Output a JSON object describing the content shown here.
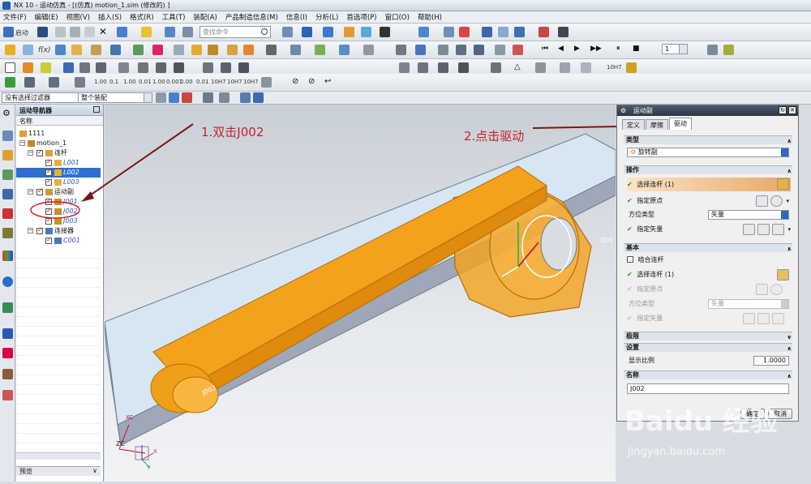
{
  "window": {
    "title": "NX 10 - 运动仿真 - [(仿真) motion_1.sim (修改的) ]"
  },
  "menu": [
    "文件(F)",
    "编辑(E)",
    "视图(V)",
    "插入(S)",
    "格式(R)",
    "工具(T)",
    "装配(A)",
    "产品制造信息(M)",
    "信息(I)",
    "分析(L)",
    "首选项(P)",
    "窗口(O)",
    "帮助(H)"
  ],
  "toolbar": {
    "start_label": "启动",
    "search_placeholder": "查找命令",
    "frame_value": "1",
    "tol_values": [
      "1.00",
      "0.1",
      "1.00",
      "0.01",
      "1.00",
      "0.001",
      "0.00",
      "0.01",
      "0.001",
      "0.0001",
      "10H7",
      "10H7",
      "10H7"
    ]
  },
  "filter": {
    "selection_filter": "没有选择过滤器",
    "assembly_scope": "整个装配"
  },
  "navigator": {
    "title": "运动导航器",
    "column_name": "名称",
    "items": [
      {
        "label": "1111",
        "indent": 0
      },
      {
        "label": "motion_1",
        "indent": 1
      },
      {
        "label": "连杆",
        "indent": 2
      },
      {
        "label": "L001",
        "indent": 3
      },
      {
        "label": "L002",
        "indent": 3
      },
      {
        "label": "L003",
        "indent": 3
      },
      {
        "label": "运动副",
        "indent": 2
      },
      {
        "label": "J001",
        "indent": 3
      },
      {
        "label": "J002",
        "indent": 3
      },
      {
        "label": "J003",
        "indent": 3
      },
      {
        "label": "连接器",
        "indent": 2
      },
      {
        "label": "C001",
        "indent": 3
      }
    ],
    "preview_label": "预览"
  },
  "viewport": {
    "labels": {
      "j002": "J002",
      "j001": "001",
      "zc": "ZC",
      "x": "X",
      "y": "Y",
      "xc": "XC"
    }
  },
  "annotations": {
    "step1": "1.双击J002",
    "step2": "2.点击驱动"
  },
  "dialog": {
    "title": "运动副",
    "tabs": [
      "定义",
      "摩擦",
      "驱动"
    ],
    "type_section": "类型",
    "type_value": "旋转副",
    "action_section": "操作",
    "select_link": "选择连杆 (1)",
    "origin": "指定原点",
    "orient_label": "方位类型",
    "orient_value": "矢量",
    "vector": "指定矢量",
    "base_section": "基本",
    "mesh_link": "啮合连杆",
    "base_select": "选择连杆 (1)",
    "base_origin": "指定原点",
    "base_orient_label": "方位类型",
    "base_orient_value": "矢量",
    "base_vector": "指定矢量",
    "limits_section": "极限",
    "settings_section": "设置",
    "scale_label": "显示比例",
    "scale_value": "1.0000",
    "name_section": "名称",
    "name_value": "J002",
    "ok": "确定",
    "cancel": "取消"
  },
  "watermark": {
    "brand": "Baidu 经验",
    "url": "jingyan.baidu.com"
  },
  "colors": {
    "link_orange": "#f4a21c",
    "annotation_red": "#c8202a",
    "dialog_bar": "#2c3847"
  }
}
